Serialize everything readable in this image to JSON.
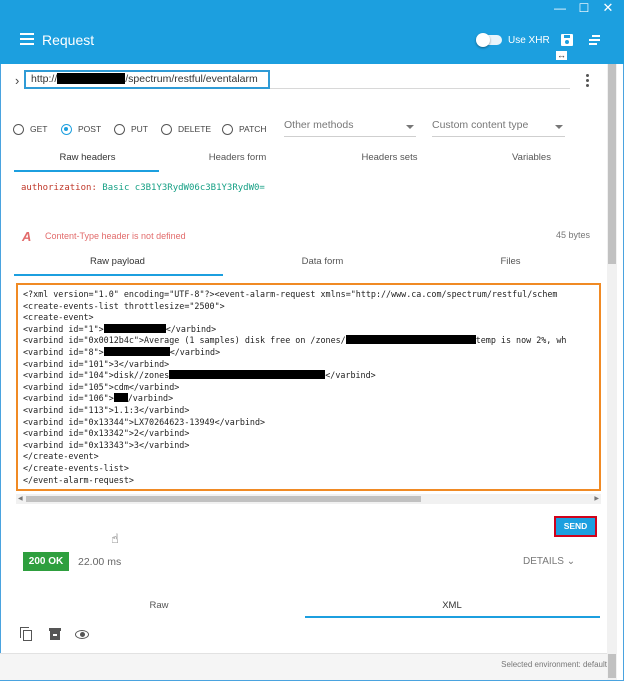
{
  "window": {
    "controls": [
      "—",
      "☐",
      "✕"
    ]
  },
  "appbar": {
    "title": "Request",
    "use_xhr_label": "Use XHR",
    "resize_hint": "↔"
  },
  "request": {
    "url_prefix": "http://",
    "url_suffix": "/spectrum/restful/eventalarm"
  },
  "methods": [
    "GET",
    "POST",
    "PUT",
    "DELETE",
    "PATCH"
  ],
  "selected_method": "POST",
  "other_methods_label": "Other methods",
  "content_type_label": "Custom content type",
  "header_tabs": [
    "Raw headers",
    "Headers form",
    "Headers sets",
    "Variables"
  ],
  "active_header_tab": "Raw headers",
  "headers": {
    "key": "authorization:",
    "value": "Basic c3B1Y3RydW06c3B1Y3RydW0="
  },
  "warning": {
    "icon": "A",
    "text": "Content-Type header is not defined",
    "size": "45 bytes"
  },
  "payload_tabs": [
    "Raw payload",
    "Data form",
    "Files"
  ],
  "active_payload_tab": "Raw payload",
  "payload_lines": [
    {
      "t": "<?xml version=\"1.0\" encoding=\"UTF-8\"?><event-alarm-request xmlns=\"http://www.ca.com/spectrum/restful/schem"
    },
    {
      "t": "<create-events-list throttlesize=\"2500\">"
    },
    {
      "t": "<create-event>"
    },
    {
      "t": "<varbind id=\"1\">",
      "r": 62,
      "t2": "</varbind>"
    },
    {
      "t": "<varbind id=\"0x0012b4c\">Average (1 samples) disk free on /zones/",
      "r": 130,
      "t2": "temp is now 2%, wh"
    },
    {
      "t": "<varbind id=\"8\">",
      "r": 66,
      "t2": "</varbind>"
    },
    {
      "t": "<varbind id=\"101\">3</varbind>"
    },
    {
      "t": "<varbind id=\"104\">disk//zones",
      "r": 156,
      "t2": "</varbind>"
    },
    {
      "t": "<varbind id=\"105\">cdm</varbind>"
    },
    {
      "t": "<varbind id=\"106\">",
      "r": 14,
      "t2": "/varbind>"
    },
    {
      "t": "<varbind id=\"113\">1.1:3</varbind>"
    },
    {
      "t": "<varbind id=\"0x13344\">LX70264623-13949</varbind>"
    },
    {
      "t": "<varbind id=\"0x13342\">2</varbind>"
    },
    {
      "t": "<varbind id=\"0x13343\">3</varbind>"
    },
    {
      "t": "</create-event>"
    },
    {
      "t": "</create-events-list>"
    },
    {
      "t": "</event-alarm-request>"
    }
  ],
  "send_label": "SEND",
  "response": {
    "status": "200 OK",
    "time": "22.00 ms",
    "details_label": "DETAILS"
  },
  "response_tabs": [
    "Raw",
    "XML"
  ],
  "active_response_tab": "XML",
  "footer": {
    "environment": "Selected environment: default"
  },
  "colors": {
    "primary": "#1c9fdf",
    "status_ok": "#2e9f3e",
    "warning": "#e26b6b",
    "highlight_orange": "#f08a24",
    "highlight_red": "#d0021b"
  }
}
